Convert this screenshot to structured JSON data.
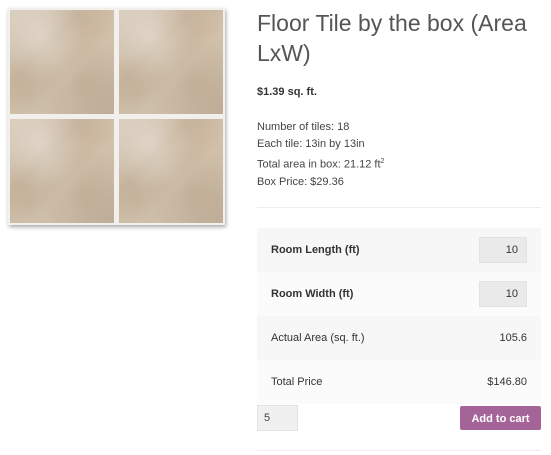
{
  "product": {
    "title": "Floor Tile by the box (Area LxW)",
    "price": "$1.39 sq. ft.",
    "details": {
      "tiles": "Number of tiles: 18",
      "each": "Each tile: 13in by 13in",
      "area_prefix": "Total area in box: 21.12 ft",
      "area_sup": "2",
      "box_price": "Box Price: $29.36"
    }
  },
  "calculator": {
    "length_label": "Room Length (ft)",
    "length_value": "10",
    "width_label": "Room Width (ft)",
    "width_value": "10",
    "area_label": "Actual Area (sq. ft.)",
    "area_value": "105.6",
    "total_label": "Total Price",
    "total_value": "$146.80"
  },
  "cart": {
    "quantity": "5",
    "add_label": "Add to cart"
  },
  "colors": {
    "button": "#a46497"
  }
}
